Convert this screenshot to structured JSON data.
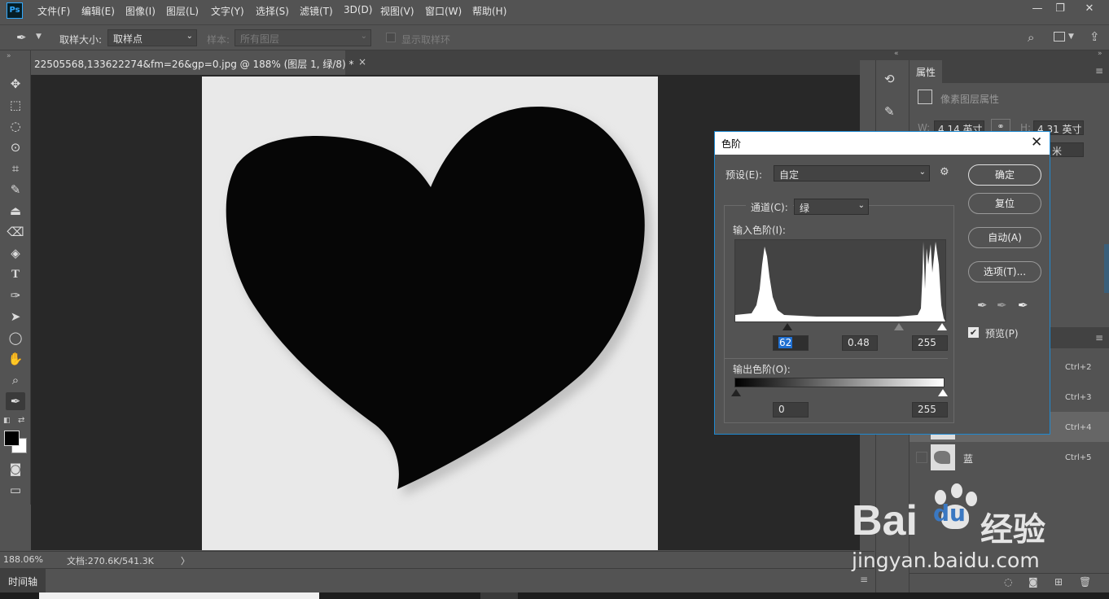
{
  "menubar": {
    "logo": "Ps",
    "items": [
      "文件(F)",
      "编辑(E)",
      "图像(I)",
      "图层(L)",
      "文字(Y)",
      "选择(S)",
      "滤镜(T)",
      "3D(D)",
      "视图(V)",
      "窗口(W)",
      "帮助(H)"
    ],
    "window_controls": [
      "minimize-icon",
      "restore-icon",
      "close-icon"
    ]
  },
  "options": {
    "sample_size_label": "取样大小:",
    "sample_size_value": "取样点",
    "sample_label": "样本:",
    "sample_value": "所有图层",
    "show_ring_label": "显示取样环"
  },
  "document": {
    "tab_title": "22505568,133622274&fm=26&gp=0.jpg @ 188% (图层 1, 绿/8) *",
    "tab_close": "×"
  },
  "status": {
    "zoom": "188.06%",
    "doc_info": "文档:270.6K/541.3K",
    "arrow": "〉"
  },
  "timeline": {
    "label": "时间轴"
  },
  "properties": {
    "tab": "属性",
    "section": "像素图层属性",
    "w_label": "W:",
    "w_value": "4.14 英寸",
    "h_label": "H:",
    "h_value": "4.31 英寸",
    "unit_partial": "米"
  },
  "layers": [
    {
      "name": "",
      "shortcut": "Ctrl+2"
    },
    {
      "name": "",
      "shortcut": "Ctrl+3"
    },
    {
      "name": "",
      "shortcut": "Ctrl+4"
    },
    {
      "name": "蓝",
      "shortcut": "Ctrl+5"
    }
  ],
  "levels": {
    "title": "色阶",
    "preset_label": "预设(E):",
    "preset_value": "自定",
    "channel_label": "通道(C):",
    "channel_value": "绿",
    "input_label": "输入色阶(I):",
    "input_black": "62",
    "input_gamma": "0.48",
    "input_white": "255",
    "output_label": "输出色阶(O):",
    "output_black": "0",
    "output_white": "255",
    "buttons": {
      "ok": "确定",
      "reset": "复位",
      "auto": "自动(A)",
      "options": "选项(T)..."
    },
    "preview_label": "预览(P)",
    "preview_checked": true
  },
  "watermark": {
    "brand": "Bai",
    "brand2": "du",
    "cn": "经验",
    "url": "jingyan.baidu.com"
  }
}
